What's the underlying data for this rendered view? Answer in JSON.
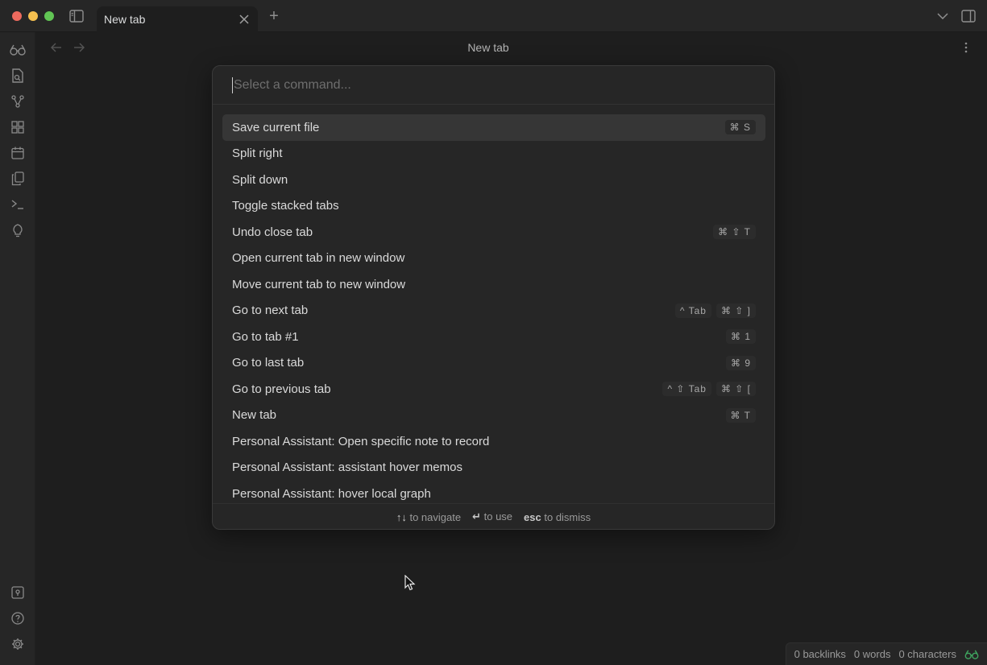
{
  "titlebar": {
    "tab_title": "New tab",
    "new_tab_symbol": "+"
  },
  "header": {
    "title": "New tab"
  },
  "palette": {
    "placeholder": "Select a command...",
    "items": [
      {
        "label": "Save current file",
        "keys": [
          "⌘ S"
        ],
        "selected": true
      },
      {
        "label": "Split right",
        "keys": []
      },
      {
        "label": "Split down",
        "keys": []
      },
      {
        "label": "Toggle stacked tabs",
        "keys": []
      },
      {
        "label": "Undo close tab",
        "keys": [
          "⌘ ⇧ T"
        ]
      },
      {
        "label": "Open current tab in new window",
        "keys": []
      },
      {
        "label": "Move current tab to new window",
        "keys": []
      },
      {
        "label": "Go to next tab",
        "keys": [
          "^ Tab",
          "⌘ ⇧ ]"
        ]
      },
      {
        "label": "Go to tab #1",
        "keys": [
          "⌘ 1"
        ]
      },
      {
        "label": "Go to last tab",
        "keys": [
          "⌘ 9"
        ]
      },
      {
        "label": "Go to previous tab",
        "keys": [
          "^ ⇧ Tab",
          "⌘ ⇧ ["
        ]
      },
      {
        "label": "New tab",
        "keys": [
          "⌘ T"
        ]
      },
      {
        "label": "Personal Assistant: Open specific note to record",
        "keys": []
      },
      {
        "label": "Personal Assistant: assistant hover memos",
        "keys": []
      },
      {
        "label": "Personal Assistant: hover local graph",
        "keys": []
      }
    ],
    "footer": {
      "navigate_key": "↑↓",
      "navigate_label": "to navigate",
      "use_key": "↵",
      "use_label": "to use",
      "dismiss_key": "esc",
      "dismiss_label": "to dismiss"
    }
  },
  "status": {
    "backlinks": "0 backlinks",
    "words": "0 words",
    "characters": "0 characters"
  },
  "colors": {
    "background": "#1e1e1e",
    "panel": "#262626",
    "selected": "#363636",
    "accent_green": "#3fa55f"
  }
}
